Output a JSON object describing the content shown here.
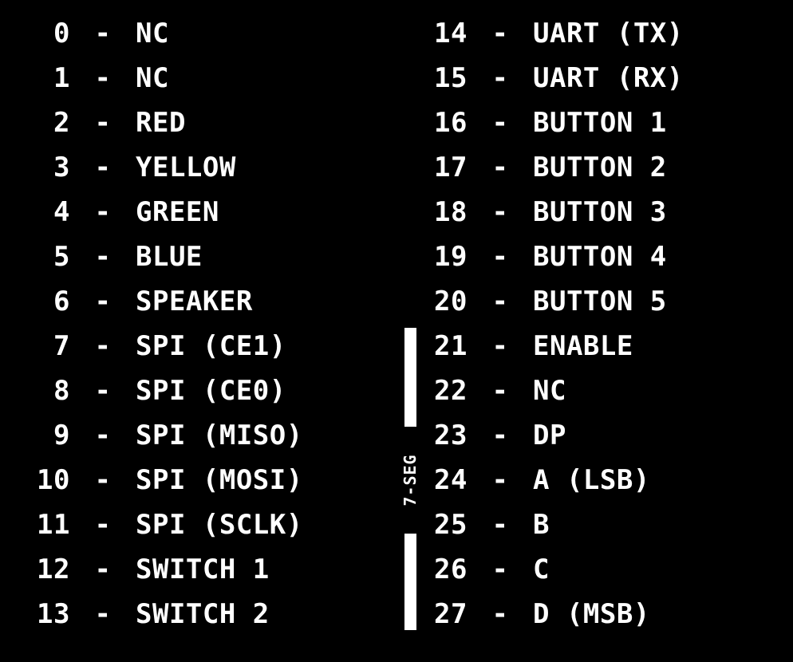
{
  "colors": {
    "background": "#000000",
    "text": "#ffffff"
  },
  "separator": "-",
  "group_label": "7-SEG",
  "left_pins": [
    {
      "num": "0",
      "label": "NC"
    },
    {
      "num": "1",
      "label": "NC"
    },
    {
      "num": "2",
      "label": "RED"
    },
    {
      "num": "3",
      "label": "YELLOW"
    },
    {
      "num": "4",
      "label": "GREEN"
    },
    {
      "num": "5",
      "label": "BLUE"
    },
    {
      "num": "6",
      "label": "SPEAKER"
    },
    {
      "num": "7",
      "label": "SPI (CE1)"
    },
    {
      "num": "8",
      "label": "SPI (CE0)"
    },
    {
      "num": "9",
      "label": "SPI (MISO)"
    },
    {
      "num": "10",
      "label": "SPI (MOSI)"
    },
    {
      "num": "11",
      "label": "SPI (SCLK)"
    },
    {
      "num": "12",
      "label": "SWITCH 1"
    },
    {
      "num": "13",
      "label": "SWITCH 2"
    }
  ],
  "right_pins": [
    {
      "num": "14",
      "label": "UART (TX)"
    },
    {
      "num": "15",
      "label": "UART (RX)"
    },
    {
      "num": "16",
      "label": "BUTTON 1"
    },
    {
      "num": "17",
      "label": "BUTTON 2"
    },
    {
      "num": "18",
      "label": "BUTTON 3"
    },
    {
      "num": "19",
      "label": "BUTTON 4"
    },
    {
      "num": "20",
      "label": "BUTTON 5"
    },
    {
      "num": "21",
      "label": "ENABLE"
    },
    {
      "num": "22",
      "label": "NC"
    },
    {
      "num": "23",
      "label": "DP"
    },
    {
      "num": "24",
      "label": "A (LSB)"
    },
    {
      "num": "25",
      "label": "B"
    },
    {
      "num": "26",
      "label": "C"
    },
    {
      "num": "27",
      "label": "D (MSB)"
    }
  ]
}
